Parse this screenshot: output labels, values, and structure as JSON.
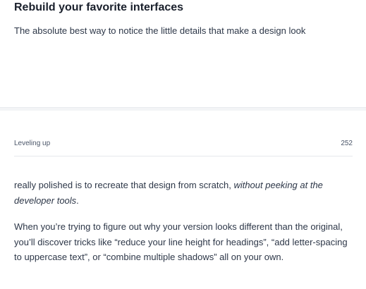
{
  "top": {
    "title": "Rebuild your favorite interfaces",
    "intro": "The absolute best way to notice the little details that make a design look"
  },
  "header": {
    "section": "Leveling up",
    "page_number": "252"
  },
  "body": {
    "para1_text": "really polished is to recreate that design from scratch, ",
    "para1_italic": "without peeking at the developer tools",
    "para1_end": ".",
    "para2": "When you’re trying to figure out why your version looks different than the original, you’ll discover tricks like “reduce your line height for headings”, “add letter-spacing to uppercase text”, or “combine multiple shadows” all on your own."
  }
}
